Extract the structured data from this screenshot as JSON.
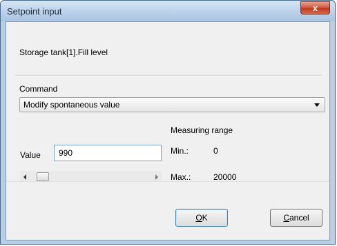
{
  "window": {
    "title": "Setpoint input",
    "close_glyph": "x"
  },
  "tag_path": "Storage tank[1].Fill level",
  "command": {
    "label": "Command",
    "selected": "Modify spontaneous value"
  },
  "value": {
    "label": "Value",
    "current": "990"
  },
  "slider": {
    "fraction": 0.0495
  },
  "measuring_range": {
    "heading": "Measuring range",
    "min_label": "Min.:",
    "min_value": "0",
    "max_label": "Max.:",
    "max_value": "20000"
  },
  "buttons": {
    "ok_mnemonic": "O",
    "ok_rest": "K",
    "cancel_mnemonic": "C",
    "cancel_rest": "ancel"
  },
  "icons": [
    "close-icon",
    "chevron-down-icon",
    "scroll-left-icon",
    "scroll-right-icon"
  ]
}
